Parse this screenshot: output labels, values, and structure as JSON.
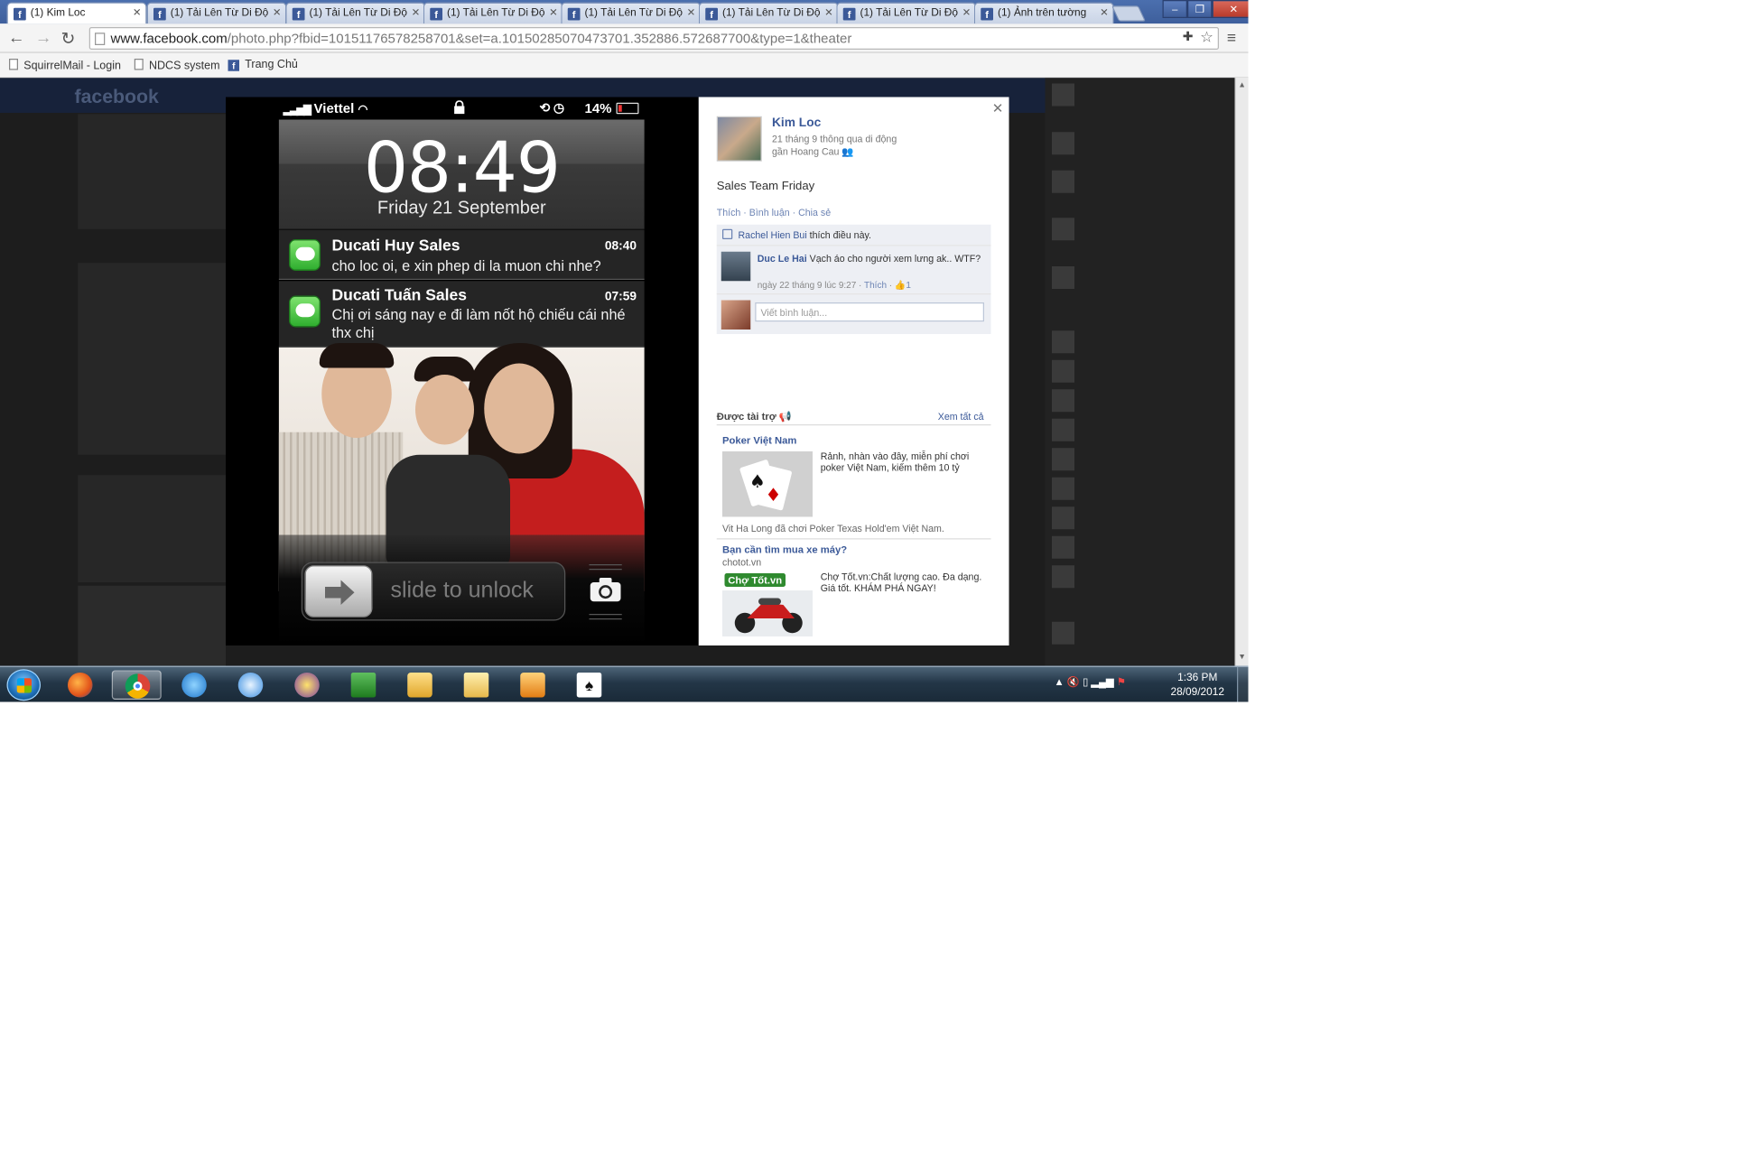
{
  "browser": {
    "tabs": [
      {
        "label": "(1) Kim Loc",
        "active": true
      },
      {
        "label": "(1) Tải Lên Từ Di Độ",
        "active": false
      },
      {
        "label": "(1) Tải Lên Từ Di Độ",
        "active": false
      },
      {
        "label": "(1) Tải Lên Từ Di Độ",
        "active": false
      },
      {
        "label": "(1) Tải Lên Từ Di Độ",
        "active": false
      },
      {
        "label": "(1) Tải Lên Từ Di Độ",
        "active": false
      },
      {
        "label": "(1) Tải Lên Từ Di Độ",
        "active": false
      },
      {
        "label": "(1) Ảnh trên tường",
        "active": false
      }
    ],
    "url_host": "www.facebook.com",
    "url_path": "/photo.php?fbid=10151176578258701&set=a.10150285070473701.352886.572687700&type=1&theater",
    "bookmarks": [
      "SquirrelMail - Login",
      "NDCS system",
      "Trang Chủ"
    ]
  },
  "backdrop": {
    "logo": "facebook"
  },
  "lockscreen": {
    "carrier": "Viettel",
    "battery": "14%",
    "battery_level": 0.14,
    "time": "08:49",
    "date": "Friday 21 September",
    "notifications": [
      {
        "sender": "Ducati Huy Sales",
        "time": "08:40",
        "message": "cho loc oi, e xin phep di la muon chi nhe?"
      },
      {
        "sender": "Ducati Tuấn Sales",
        "time": "07:59",
        "message": "Chị ơi sáng nay e đi làm nốt hộ chiếu cái nhé thx chị"
      }
    ],
    "slider_text": "slide to unlock"
  },
  "photo_info": {
    "owner": "Kim Loc",
    "posted": "21 tháng 9 thông qua di động",
    "location": "gần Hoang Cau",
    "caption": "Sales Team Friday",
    "actions": "Thích · Bình luận · Chia sẻ",
    "like_name": "Rachel Hien Bui",
    "like_suffix": "thích điều này.",
    "comment": {
      "author": "Duc Le Hai",
      "text": "Vạch áo cho người xem lưng ak.. WTF?",
      "date": "ngày 22 tháng 9 lúc 9:27",
      "like_link": "Thích",
      "likes": "1"
    },
    "comment_placeholder": "Viết bình luận...",
    "ads_header": "Được tài trợ",
    "ads_see_all": "Xem tất cả",
    "ads": [
      {
        "title": "Poker Việt Nam",
        "desc": "Rảnh, nhàn vào đây, miễn phí chơi poker Việt Nam, kiếm thêm 10 tỷ",
        "social": "Vit Ha Long đã chơi Poker Texas Hold'em Việt Nam."
      },
      {
        "title": "Bạn cần tìm mua xe máy?",
        "site": "chotot.vn",
        "desc": "Chợ Tốt.vn:Chất lượng cao. Đa dạng. Giá tốt. KHÁM PHÁ NGAY!",
        "banner": "Chợ Tốt.vn"
      }
    ]
  },
  "taskbar": {
    "time": "1:36 PM",
    "date": "28/09/2012"
  }
}
